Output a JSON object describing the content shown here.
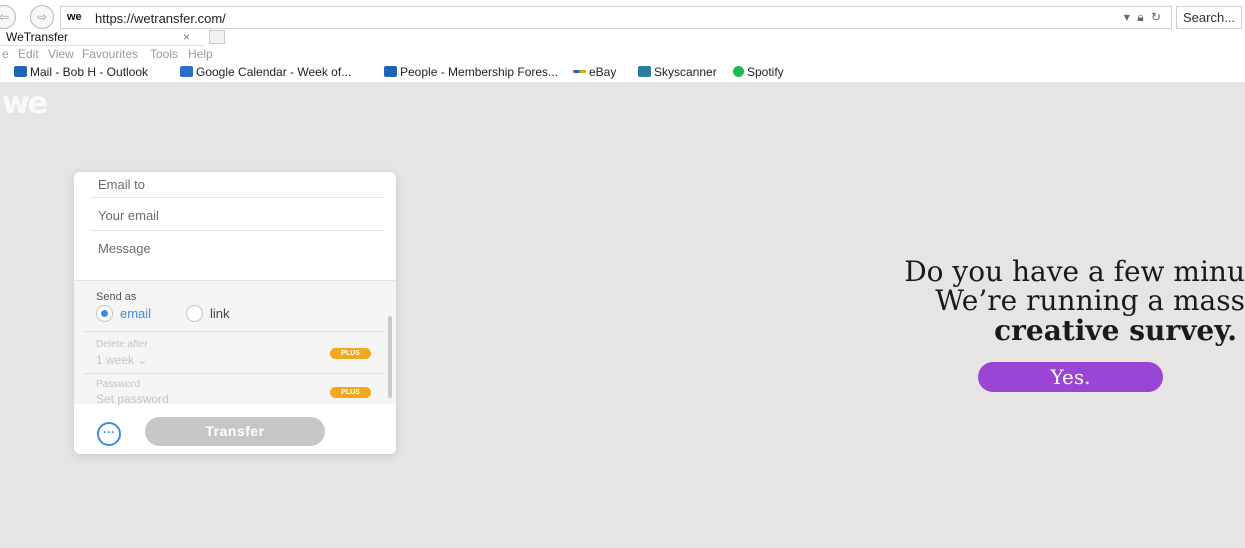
{
  "browser": {
    "url": "https://wetransfer.com/",
    "favicon_text": "we",
    "search_placeholder": "Search...",
    "tab_title": "WeTransfer",
    "tab_close": "×",
    "menu": [
      "e",
      "Edit",
      "View",
      "Favourites",
      "Tools",
      "Help"
    ],
    "favorites": [
      {
        "label": "Mail - Bob H - Outlook",
        "icon": "outlook-icon",
        "color": "#1f63b5"
      },
      {
        "label": "Google Calendar - Week of...",
        "icon": "calendar-icon",
        "color": "#2b6fc4"
      },
      {
        "label": "People - Membership Fores...",
        "icon": "outlook-icon",
        "color": "#1f63b5"
      },
      {
        "label": "eBay",
        "icon": "ebay-icon",
        "color": "#e53238"
      },
      {
        "label": "Skyscanner",
        "icon": "skyscanner-icon",
        "color": "#2a7d9e"
      },
      {
        "label": "Spotify",
        "icon": "spotify-icon",
        "color": "#1db954"
      }
    ]
  },
  "page": {
    "logo": "we",
    "form": {
      "email_to_placeholder": "Email to",
      "your_email_placeholder": "Your email",
      "message_placeholder": "Message",
      "send_as_label": "Send as",
      "send_as_options": [
        {
          "label": "email",
          "selected": true
        },
        {
          "label": "link",
          "selected": false
        }
      ],
      "delete_after_label": "Delete after",
      "delete_after_value": "1 week",
      "password_label": "Password",
      "password_placeholder": "Set password",
      "plus_badge": "PLUS",
      "more_label": "···",
      "transfer_label": "Transfer"
    },
    "promo": {
      "line1": "Do you have a few minu",
      "line2": "We’re running a mass",
      "line3": "creative survey.",
      "button": "Yes."
    },
    "colors": {
      "accent_blue": "#3a8ee6",
      "plus_badge": "#f2a81d",
      "yes_button": "#9b45d6",
      "background": "#e7e5e3"
    }
  }
}
